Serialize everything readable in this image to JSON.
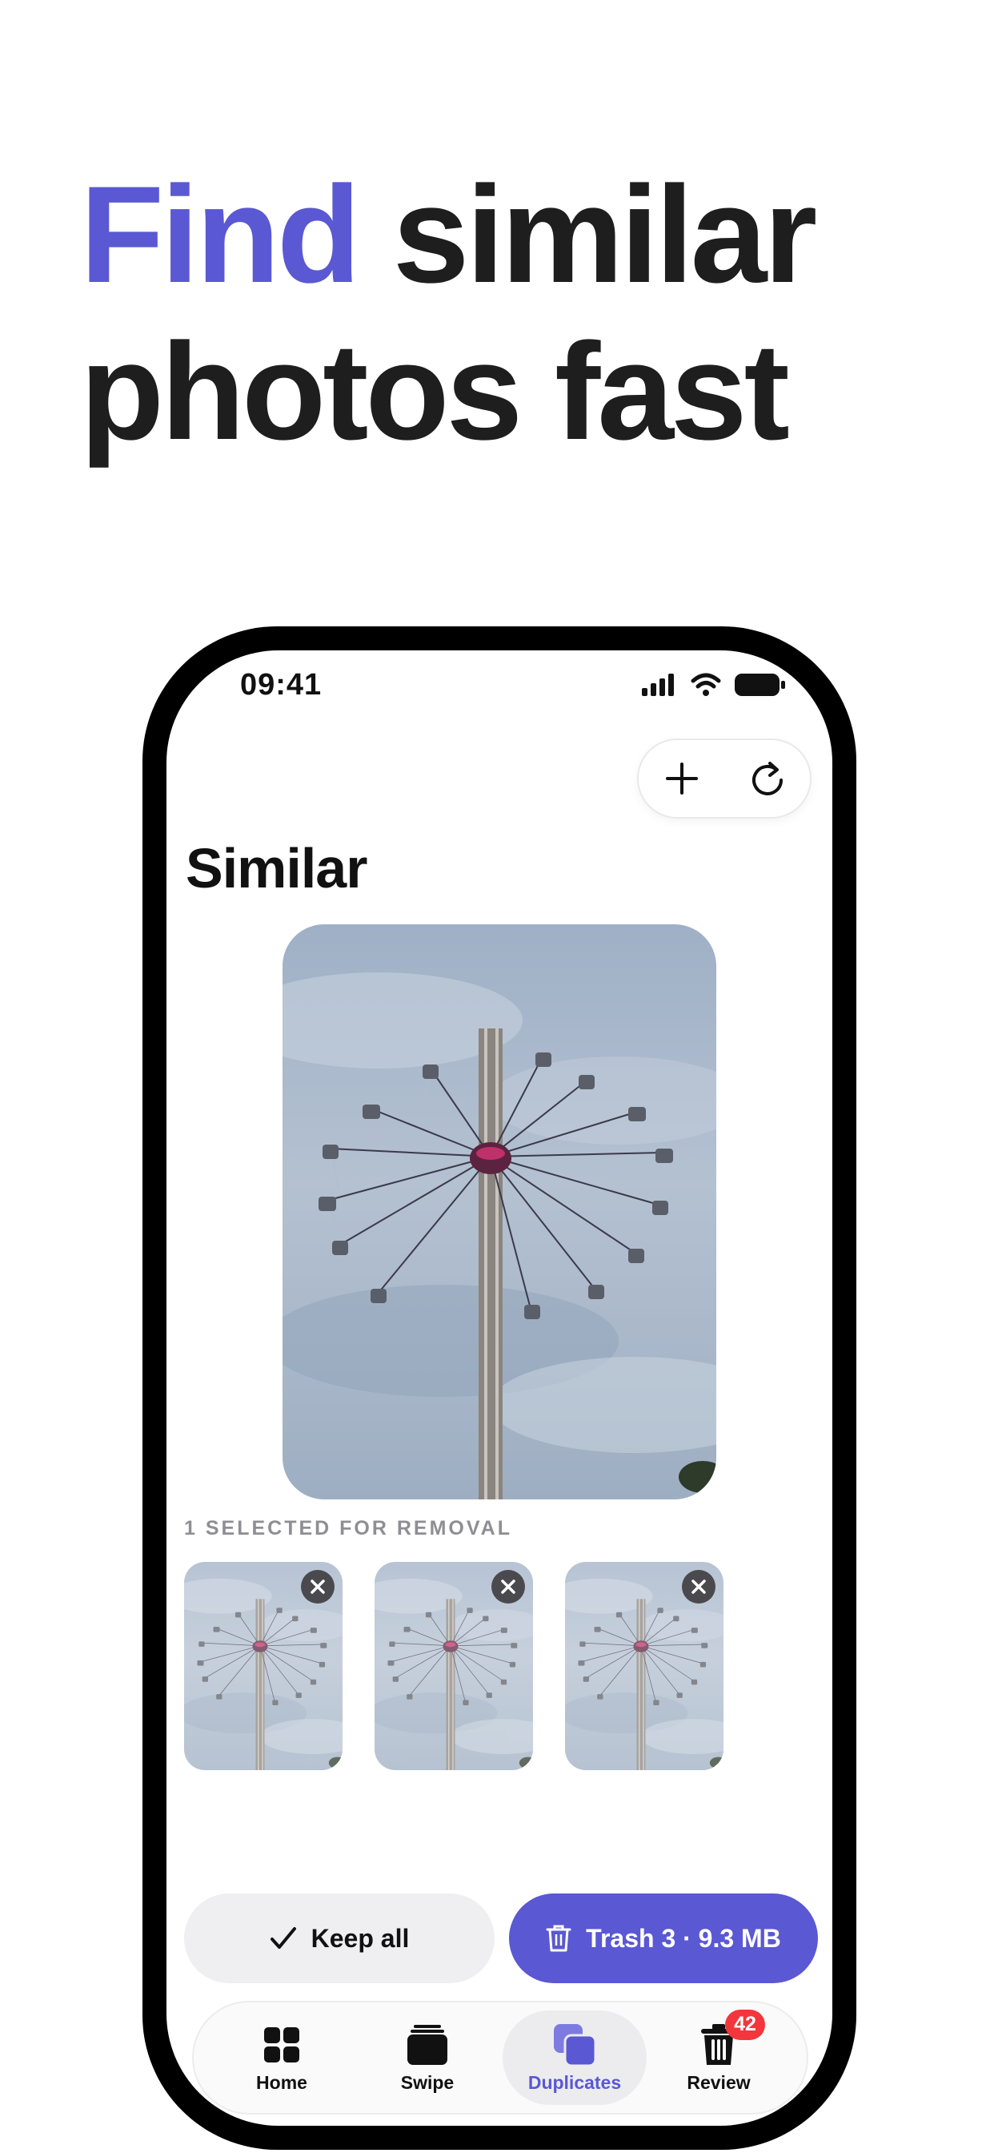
{
  "headline": {
    "accent": "Find",
    "rest_line1": "similar",
    "line2": "photos fast"
  },
  "status_bar": {
    "time": "09:41"
  },
  "toolbar": {
    "add_icon": "plus-icon",
    "refresh_icon": "refresh-icon"
  },
  "screen": {
    "title": "Similar"
  },
  "selection": {
    "label": "1 SELECTED FOR REMOVAL"
  },
  "thumbnails": [
    {
      "remove_icon": "close-icon"
    },
    {
      "remove_icon": "close-icon"
    },
    {
      "remove_icon": "close-icon"
    }
  ],
  "actions": {
    "keep_label": "Keep all",
    "trash_label": "Trash 3 · 9.3 MB"
  },
  "tabs": [
    {
      "label": "Home",
      "icon": "grid-icon"
    },
    {
      "label": "Swipe",
      "icon": "cards-icon"
    },
    {
      "label": "Duplicates",
      "icon": "duplicates-icon",
      "active": true
    },
    {
      "label": "Review",
      "icon": "trash-icon",
      "badge": "42"
    }
  ],
  "colors": {
    "accent": "#5a58d3",
    "badge": "#f2363c",
    "sky": "#a8b6c8"
  }
}
